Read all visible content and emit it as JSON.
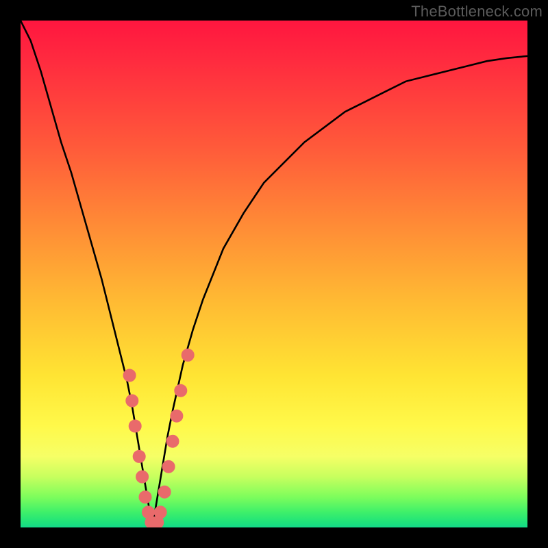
{
  "watermark": "TheBottleneck.com",
  "colors": {
    "curve_stroke": "#000000",
    "marker_fill": "#e96a6b",
    "marker_stroke": "#e96a6b"
  },
  "chart_data": {
    "type": "line",
    "title": "",
    "xlabel": "",
    "ylabel": "",
    "xlim": [
      0,
      100
    ],
    "ylim": [
      0,
      100
    ],
    "x": [
      0,
      2,
      4,
      6,
      8,
      10,
      12,
      14,
      16,
      18,
      20,
      21,
      22,
      23,
      24,
      25,
      26,
      27,
      28,
      29,
      30,
      32,
      34,
      36,
      38,
      40,
      44,
      48,
      52,
      56,
      60,
      64,
      68,
      72,
      76,
      80,
      84,
      88,
      92,
      96,
      100
    ],
    "y": [
      100,
      96,
      90,
      83,
      76,
      70,
      63,
      56,
      49,
      41,
      33,
      29,
      24,
      18,
      12,
      6,
      0,
      6,
      12,
      18,
      23,
      32,
      39,
      45,
      50,
      55,
      62,
      68,
      72,
      76,
      79,
      82,
      84,
      86,
      88,
      89,
      90,
      91,
      92,
      92.6,
      93
    ],
    "markers": [
      {
        "x": 21.5,
        "y": 30
      },
      {
        "x": 22.0,
        "y": 25
      },
      {
        "x": 22.6,
        "y": 20
      },
      {
        "x": 23.4,
        "y": 14
      },
      {
        "x": 24.0,
        "y": 10
      },
      {
        "x": 24.6,
        "y": 6
      },
      {
        "x": 25.2,
        "y": 3
      },
      {
        "x": 25.8,
        "y": 1
      },
      {
        "x": 26.4,
        "y": 0.5
      },
      {
        "x": 27.0,
        "y": 1
      },
      {
        "x": 27.6,
        "y": 3
      },
      {
        "x": 28.4,
        "y": 7
      },
      {
        "x": 29.2,
        "y": 12
      },
      {
        "x": 30.0,
        "y": 17
      },
      {
        "x": 30.8,
        "y": 22
      },
      {
        "x": 31.6,
        "y": 27
      },
      {
        "x": 33.0,
        "y": 34
      }
    ]
  }
}
